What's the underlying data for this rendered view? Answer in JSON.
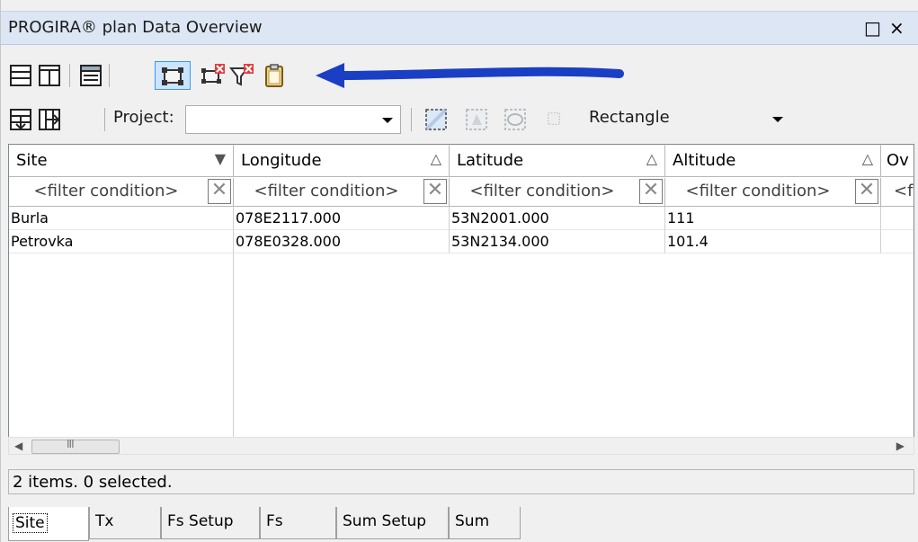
{
  "window": {
    "title": "PROGIRA® plan Data Overview",
    "restore_glyph": "□",
    "close_glyph": "×"
  },
  "toolbar1": {
    "icons": [
      "split-horizontal-icon",
      "split-vertical-icon",
      "list-view-icon",
      "select-rectangle-icon",
      "clear-selection-icon",
      "clear-filter-icon",
      "clipboard-icon"
    ]
  },
  "annotation": {
    "color": "#1a3fc4"
  },
  "toolbar2": {
    "project_label": "Project:",
    "project_value": "",
    "shape_value": "Rectangle"
  },
  "grid": {
    "columns": [
      {
        "label": "Site",
        "sort": "▼"
      },
      {
        "label": "Longitude",
        "sort": "△"
      },
      {
        "label": "Latitude",
        "sort": "△"
      },
      {
        "label": "Altitude",
        "sort": "△"
      },
      {
        "label": "Ov",
        "sort": ""
      }
    ],
    "filter_placeholder": "<filter condition>",
    "filter_partial": "<f",
    "clear_glyph": "✕",
    "rows": [
      {
        "site": "Burla",
        "longitude": "078E2117.000",
        "latitude": "53N2001.000",
        "altitude": "111"
      },
      {
        "site": "Petrovka",
        "longitude": "078E0328.000",
        "latitude": "53N2134.000",
        "altitude": "101.4"
      }
    ]
  },
  "scrollbar": {
    "left_arrow": "◀",
    "right_arrow": "▶",
    "grip": "III"
  },
  "status": {
    "text": "2 items. 0 selected."
  },
  "tabs": [
    "Site",
    "Tx",
    "Fs Setup",
    "Fs",
    "Sum Setup",
    "Sum"
  ],
  "selected_tab": "Site",
  "colors": {
    "titlebar": "#dce6f4",
    "accent": "#3399ff"
  }
}
